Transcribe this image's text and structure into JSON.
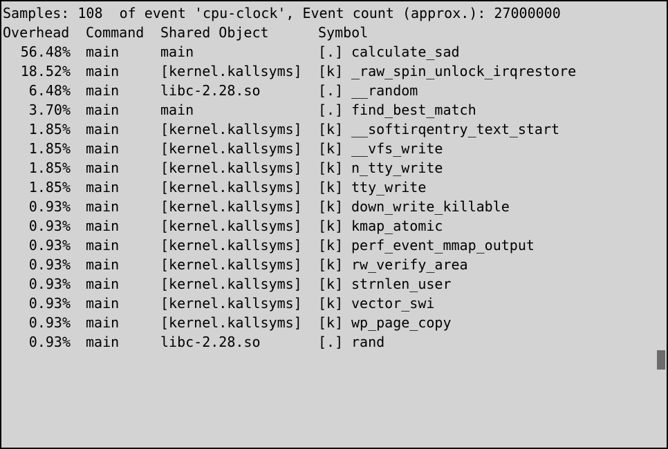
{
  "summary": "Samples: 108  of event 'cpu-clock', Event count (approx.): 27000000",
  "headers": {
    "overhead": "Overhead",
    "command": "Command",
    "shared_object": "Shared Object",
    "symbol": "Symbol"
  },
  "rows": [
    {
      "overhead": "56.48%",
      "command": "main",
      "object": "main",
      "type": "[.]",
      "symbol": "calculate_sad"
    },
    {
      "overhead": "18.52%",
      "command": "main",
      "object": "[kernel.kallsyms]",
      "type": "[k]",
      "symbol": "_raw_spin_unlock_irqrestore"
    },
    {
      "overhead": "6.48%",
      "command": "main",
      "object": "libc-2.28.so",
      "type": "[.]",
      "symbol": "__random"
    },
    {
      "overhead": "3.70%",
      "command": "main",
      "object": "main",
      "type": "[.]",
      "symbol": "find_best_match"
    },
    {
      "overhead": "1.85%",
      "command": "main",
      "object": "[kernel.kallsyms]",
      "type": "[k]",
      "symbol": "__softirqentry_text_start"
    },
    {
      "overhead": "1.85%",
      "command": "main",
      "object": "[kernel.kallsyms]",
      "type": "[k]",
      "symbol": "__vfs_write"
    },
    {
      "overhead": "1.85%",
      "command": "main",
      "object": "[kernel.kallsyms]",
      "type": "[k]",
      "symbol": "n_tty_write"
    },
    {
      "overhead": "1.85%",
      "command": "main",
      "object": "[kernel.kallsyms]",
      "type": "[k]",
      "symbol": "tty_write"
    },
    {
      "overhead": "0.93%",
      "command": "main",
      "object": "[kernel.kallsyms]",
      "type": "[k]",
      "symbol": "down_write_killable"
    },
    {
      "overhead": "0.93%",
      "command": "main",
      "object": "[kernel.kallsyms]",
      "type": "[k]",
      "symbol": "kmap_atomic"
    },
    {
      "overhead": "0.93%",
      "command": "main",
      "object": "[kernel.kallsyms]",
      "type": "[k]",
      "symbol": "perf_event_mmap_output"
    },
    {
      "overhead": "0.93%",
      "command": "main",
      "object": "[kernel.kallsyms]",
      "type": "[k]",
      "symbol": "rw_verify_area"
    },
    {
      "overhead": "0.93%",
      "command": "main",
      "object": "[kernel.kallsyms]",
      "type": "[k]",
      "symbol": "strnlen_user"
    },
    {
      "overhead": "0.93%",
      "command": "main",
      "object": "[kernel.kallsyms]",
      "type": "[k]",
      "symbol": "vector_swi"
    },
    {
      "overhead": "0.93%",
      "command": "main",
      "object": "[kernel.kallsyms]",
      "type": "[k]",
      "symbol": "wp_page_copy"
    },
    {
      "overhead": "0.93%",
      "command": "main",
      "object": "libc-2.28.so",
      "type": "[.]",
      "symbol": "rand"
    }
  ],
  "colors": {
    "background": "#d3d3d3",
    "text": "#000000",
    "cursor": "#6b6b6b"
  }
}
